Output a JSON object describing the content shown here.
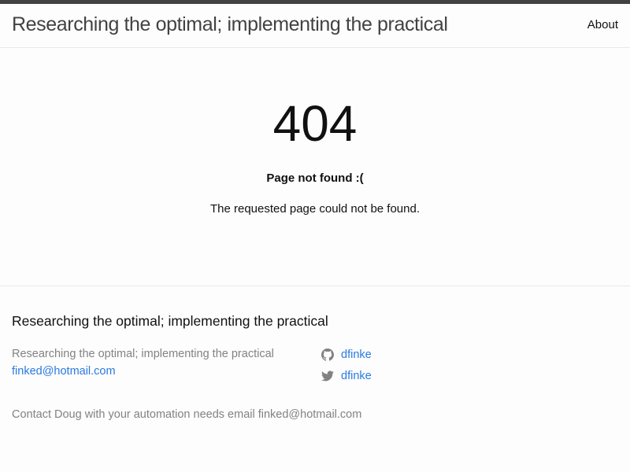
{
  "header": {
    "site_title": "Researching the optimal; implementing the practical",
    "nav_about": "About"
  },
  "main": {
    "error_code": "404",
    "error_heading": "Page not found :(",
    "error_message": "The requested page could not be found."
  },
  "footer": {
    "heading": "Researching the optimal; implementing the practical",
    "tagline": "Researching the optimal; implementing the practical",
    "email": "finked@hotmail.com",
    "github_username": "dfinke",
    "twitter_username": "dfinke",
    "description": "Contact Doug with your automation needs email finked@hotmail.com",
    "icons": [
      "github-icon",
      "twitter-icon"
    ]
  },
  "colors": {
    "topbar": "#424242",
    "link": "#2a7ae2",
    "muted": "#828282"
  }
}
